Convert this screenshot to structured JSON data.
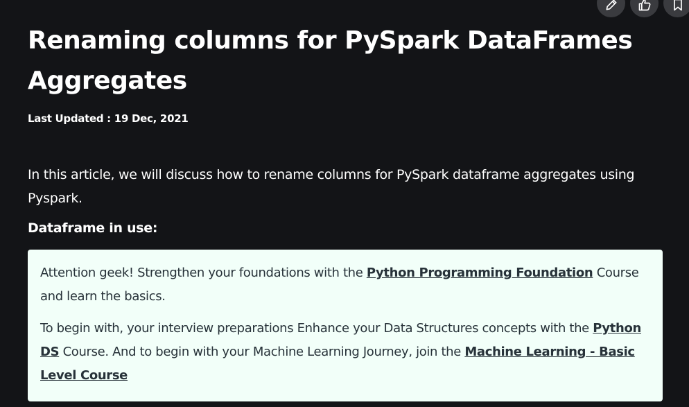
{
  "article": {
    "title": "Renaming columns for PySpark DataFrames Aggregates",
    "last_updated": "Last Updated : 19 Dec, 2021",
    "intro": "In this article, we will discuss how to rename columns for PySpark dataframe aggregates using Pyspark.",
    "subheading": "Dataframe in use:"
  },
  "toolbar": {
    "icons": [
      "pencil-icon",
      "thumbs-up-icon",
      "bookmark-icon"
    ]
  },
  "callout": {
    "p1_pre": " Attention geek! Strengthen your foundations with the ",
    "p1_link": "Python Programming Foundation",
    "p1_post": " Course and learn the basics.",
    "p2_pre": "To begin with, your interview preparations Enhance your Data Structures concepts with the ",
    "p2_link1": "Python DS",
    "p2_mid": " Course. And to begin with your Machine Learning Journey, join the ",
    "p2_link2": "Machine Learning - Basic Level Course"
  },
  "colors": {
    "background": "#131417",
    "callout_bg": "#f2fff9",
    "callout_text": "#273239",
    "button_bg": "#3a3b3f"
  }
}
